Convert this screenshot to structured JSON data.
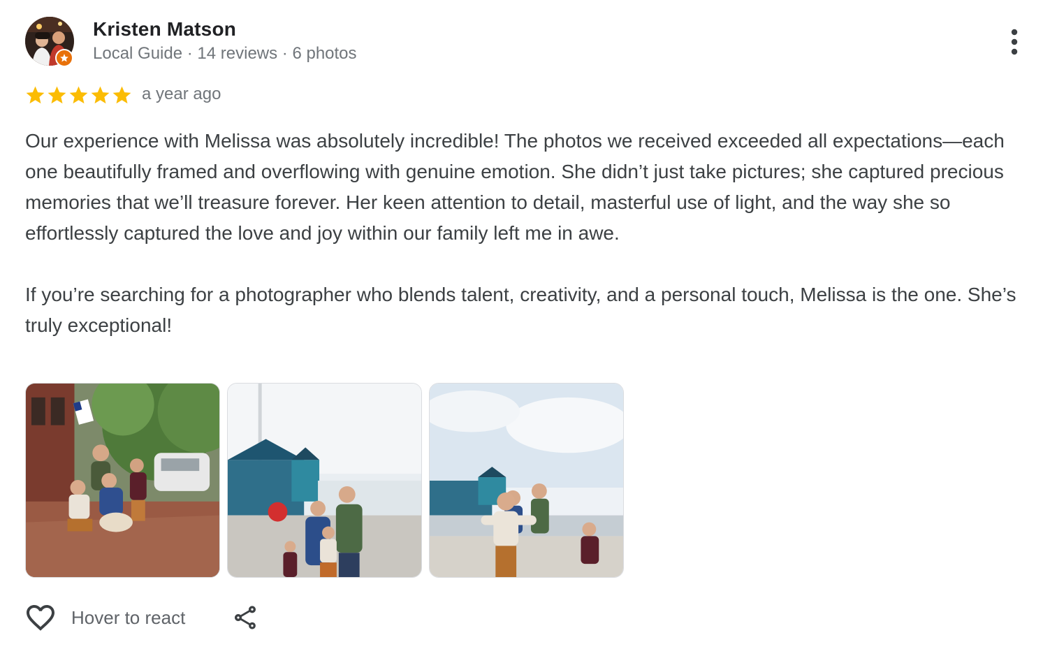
{
  "reviewer": {
    "name": "Kristen Matson",
    "meta": "Local Guide · 14 reviews · 6 photos",
    "avatar_icon": "avatar-photo",
    "badge_icon": "local-guide-star-icon",
    "badge_color": "#e8710a"
  },
  "menu": {
    "icon": "more-vert-icon"
  },
  "rating": {
    "stars": 5,
    "max_stars": 5,
    "star_color": "#fbbc04",
    "date": "a year ago"
  },
  "review": {
    "paragraphs": [
      "Our experience with Melissa was absolutely incredible! The photos we received exceeded all expectations—each one beautifully framed and overflowing with genuine emotion. She didn’t just take pictures; she captured precious memories that we’ll treasure forever. Her keen attention to detail, masterful use of light, and the way she so effortlessly captured the love and joy within our family left me in awe.",
      "If you’re searching for a photographer who blends talent, creativity, and a personal touch, Melissa is the one. She’s truly exceptional!"
    ]
  },
  "photos": [
    {
      "icon": "photo-family-street"
    },
    {
      "icon": "photo-family-harbor"
    },
    {
      "icon": "photo-family-pier"
    }
  ],
  "actions": {
    "react_label": "Hover to react",
    "like_icon": "heart-outline-icon",
    "share_icon": "share-icon"
  }
}
